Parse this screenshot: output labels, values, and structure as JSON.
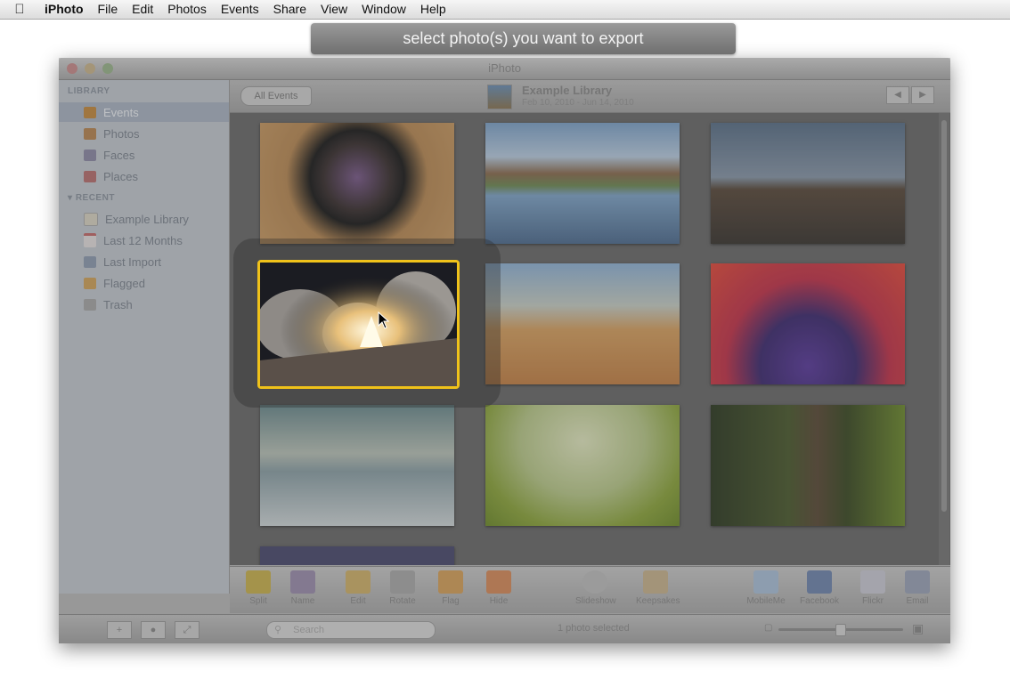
{
  "menubar": {
    "app_name": "iPhoto",
    "items": [
      "File",
      "Edit",
      "Photos",
      "Events",
      "Share",
      "View",
      "Window",
      "Help"
    ]
  },
  "banner": {
    "text": "select photo(s) you want to export"
  },
  "window": {
    "title": "iPhoto"
  },
  "sidebar": {
    "library_header": "LIBRARY",
    "library_items": [
      {
        "label": "Events",
        "icon": "events-icon",
        "selected": true
      },
      {
        "label": "Photos",
        "icon": "photos-icon"
      },
      {
        "label": "Faces",
        "icon": "faces-icon"
      },
      {
        "label": "Places",
        "icon": "places-icon"
      }
    ],
    "recent_header": "RECENT",
    "recent_items": [
      {
        "label": "Example Library",
        "icon": "library-icon"
      },
      {
        "label": "Last 12 Months",
        "icon": "calendar-icon"
      },
      {
        "label": "Last Import",
        "icon": "import-icon"
      },
      {
        "label": "Flagged",
        "icon": "flag-icon"
      },
      {
        "label": "Trash",
        "icon": "trash-icon"
      }
    ]
  },
  "header": {
    "all_events_label": "All Events",
    "library_name": "Example Library",
    "library_dates": "Feb 10, 2010 - Jun 14, 2010"
  },
  "photos": [
    {
      "name": "camera-lens-photo"
    },
    {
      "name": "lake-reflection-photo"
    },
    {
      "name": "pier-lights-photo"
    },
    {
      "name": "rocket-launch-photo",
      "selected": true
    },
    {
      "name": "desert-dunes-photo"
    },
    {
      "name": "purple-flower-photo"
    },
    {
      "name": "snowy-landscape-photo"
    },
    {
      "name": "dragonfly-leaf-photo"
    },
    {
      "name": "forest-tree-photo"
    },
    {
      "name": "partial-photo"
    }
  ],
  "toolbar": {
    "buttons": [
      {
        "label": "Split",
        "icon": "split-icon"
      },
      {
        "label": "Name",
        "icon": "name-icon"
      },
      {
        "label": "Edit",
        "icon": "edit-icon"
      },
      {
        "label": "Rotate",
        "icon": "rotate-icon"
      },
      {
        "label": "Flag",
        "icon": "flag-icon"
      },
      {
        "label": "Hide",
        "icon": "hide-icon"
      },
      {
        "label": "Slideshow",
        "icon": "slideshow-icon"
      },
      {
        "label": "Keepsakes",
        "icon": "keepsakes-icon"
      },
      {
        "label": "MobileMe",
        "icon": "mobileme-icon"
      },
      {
        "label": "Facebook",
        "icon": "facebook-icon"
      },
      {
        "label": "Flickr",
        "icon": "flickr-icon"
      },
      {
        "label": "Email",
        "icon": "email-icon"
      }
    ]
  },
  "bottombar": {
    "search_placeholder": "Search",
    "status": "1 photo selected"
  },
  "colors": {
    "selection": "#f0c21a",
    "banner_bg": "#808080"
  }
}
